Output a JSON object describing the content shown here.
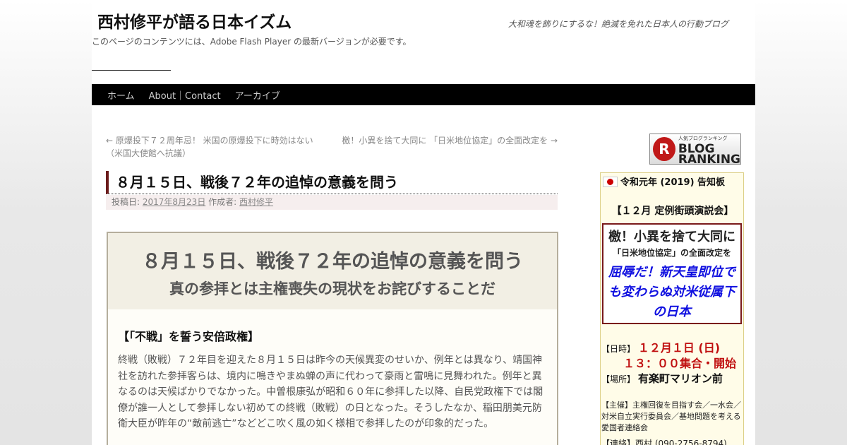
{
  "header": {
    "site_title": "西村修平が語る日本イズム",
    "site_description": "大和魂を飾りにするな！絶滅を免れた日本人の行動ブログ",
    "flash_note": "このページのコンテンツには、Adobe Flash Player の最新バージョンが必要です。"
  },
  "nav": {
    "items": [
      "ホーム",
      "About｜Contact",
      "アーカイブ"
    ]
  },
  "post_nav": {
    "prev": "← 原爆投下７２周年忌！ 米国の原爆投下に時効はない（米国大使館へ抗議）",
    "next": "檄！小異を捨て大同に 「日米地位協定」の全面改定を →"
  },
  "post": {
    "title": "８月１５日、戦後７２年の追悼の意義を問う",
    "meta_posted": "投稿日:",
    "date": "2017年8月23日",
    "meta_author": "作成者:",
    "author": "西村修平"
  },
  "article": {
    "heading": "８月１５日、戦後７２年の追悼の意義を問う",
    "subheading": "真の参拝とは主権喪失の現状をお詫びすることだ",
    "section_title": "【「不戦」を誓う安倍政権】",
    "paragraph": "終戦（敗戦）７２年目を迎えた８月１５日は昨今の天候異変のせいか、例年とは異なり、靖国神社を訪れた参拝客らは、境内に鳴きやまぬ蝉の声に代わって豪雨と雷鳴に見舞われた。例年と異なるのは天候ばかりでなかった。中曽根康弘が昭和６０年に参拝した以降、自民党政権下では閣僚が誰一人として参拝しない初めての終戦（敗戦）の日となった。そうしたなか、稲田朋美元防衛大臣が昨年の“敵前逃亡”などどこ吹く風の如く様相で参拝したのが印象的だった。"
  },
  "ranking_banner": {
    "badge": "R",
    "small_text": "人気ブログランキング",
    "line1": "BLOG",
    "line2": "RANKING"
  },
  "sidebar": {
    "notice_head": "令和元年 (2019) 告知板",
    "event_title": "【１２月 定例街頭演説会】",
    "frame_line1": "檄！小異を捨て大同に",
    "frame_line2": "「日米地位協定」の全面改定を",
    "frame_line3": "屈辱だ！新天皇即位でも変わらぬ対米従属下の日本",
    "date_label": "【日時】",
    "date_value": "１２月１日 (日)",
    "time_value": "１３：００集合・開始",
    "place_label": "【場所】",
    "place_value": "有楽町マリオン前",
    "organizer": "【主催】主権回復を目指す会／一水会／対米自立実行委員会／基地問題を考える愛国者連絡会",
    "contact": "【連絡】西村 (090-2756-8794)"
  }
}
